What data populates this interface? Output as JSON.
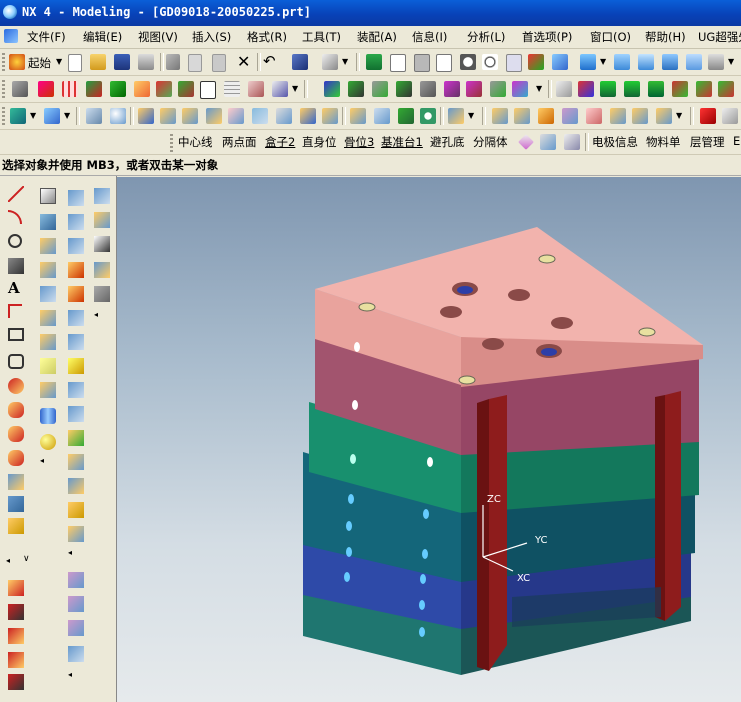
{
  "window": {
    "title": "NX 4 - Modeling - [GD09018-20050225.prt]"
  },
  "menubar": {
    "items": [
      "文件(F)",
      "编辑(E)",
      "视图(V)",
      "插入(S)",
      "格式(R)",
      "工具(T)",
      "装配(A)",
      "信息(I)",
      "分析(L)",
      "首选项(P)",
      "窗口(O)",
      "帮助(H)",
      "UG超强外"
    ]
  },
  "toolbar1": {
    "start_label": "起始"
  },
  "toolbar4": {
    "items": [
      "中心线",
      "两点面",
      "盒子2",
      "直身位",
      "骨位3",
      "基准台1",
      "避孔底",
      "分隔体",
      "电极信息",
      "物料单",
      "层管理",
      "EF"
    ]
  },
  "status": {
    "prompt": "选择对象并使用 MB3，或者双击某一对象"
  },
  "viewport": {
    "axis_labels": {
      "z": "ZC",
      "y": "YC",
      "x": "XC"
    },
    "colors": {
      "top_plate": "#f2b3ad",
      "plate2": "#a2546e",
      "plate3": "#148a6a",
      "plate4": "#116070",
      "plate5": "#29429a",
      "plate6": "#1a6a68",
      "rails": "#8e1c1c",
      "background_top": "#7f96b0",
      "background_bottom": "#e6eaec"
    }
  }
}
